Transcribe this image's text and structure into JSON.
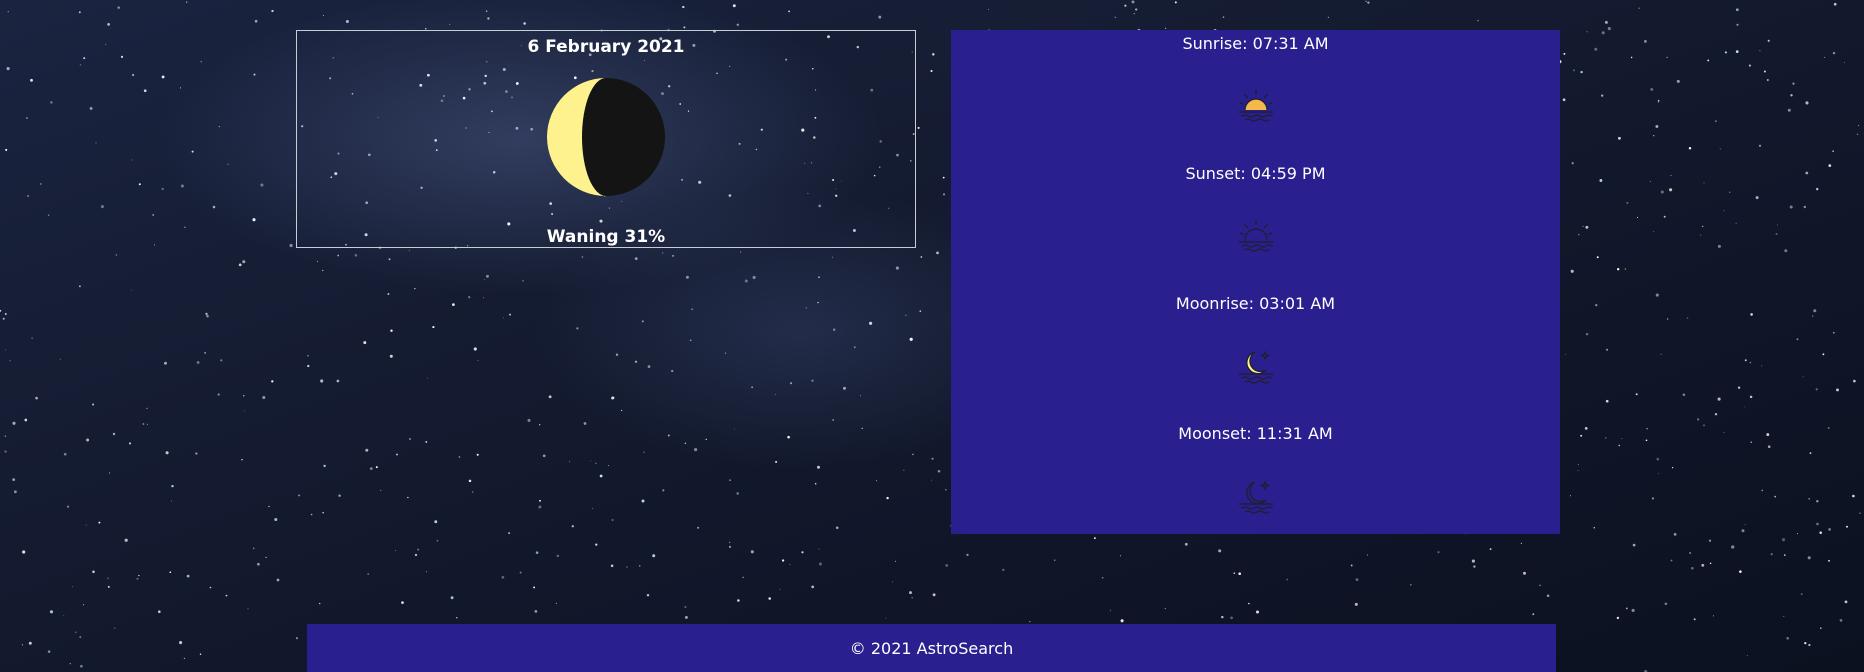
{
  "moon": {
    "date": "6 February 2021",
    "phase": "Waning 31%",
    "illumination": 0.31,
    "icon": "moon-phase-icon"
  },
  "events": [
    {
      "label": "Sunrise: 07:31 AM",
      "icon": "sunrise-icon"
    },
    {
      "label": "Sunset: 04:59 PM",
      "icon": "sunset-icon"
    },
    {
      "label": "Moonrise: 03:01 AM",
      "icon": "moonrise-icon"
    },
    {
      "label": "Moonset: 11:31 AM",
      "icon": "moonset-icon"
    }
  ],
  "footer": {
    "text": "© 2021 AstroSearch"
  },
  "colors": {
    "panel": "#2a1f8f",
    "moon_lit": "#fdf28e",
    "moon_dark": "#141414",
    "sun": "#f5b84a",
    "icon_line": "#1f1f2e"
  }
}
